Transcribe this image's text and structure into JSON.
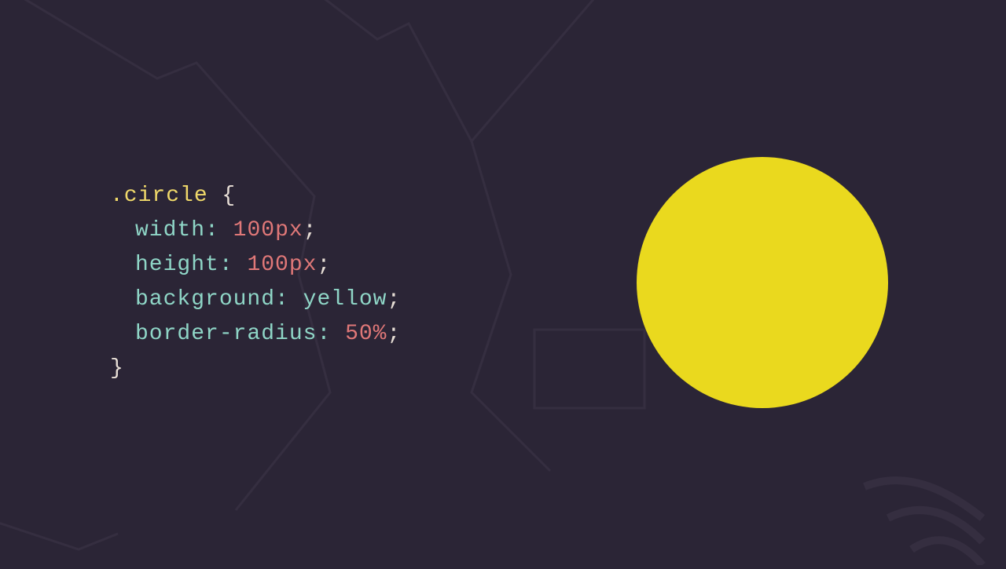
{
  "code": {
    "selector": ".circle",
    "open_brace": " {",
    "close_brace": "}",
    "props": {
      "width": {
        "name": "width",
        "colon": ":",
        "space": " ",
        "value": "100",
        "unit": "px",
        "semi": ";"
      },
      "height": {
        "name": "height",
        "colon": ":",
        "space": " ",
        "value": "100",
        "unit": "px",
        "semi": ";"
      },
      "background": {
        "name": "background",
        "colon": ":",
        "space": " ",
        "value": "yellow",
        "semi": ";"
      },
      "border_radius": {
        "name": "border-radius",
        "colon": ":",
        "space": " ",
        "value": "50",
        "unit": "%",
        "semi": ";"
      }
    }
  },
  "output": {
    "color": "#ead91e"
  }
}
